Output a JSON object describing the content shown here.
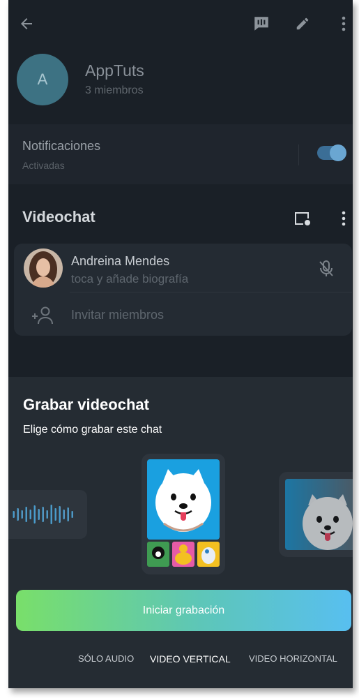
{
  "header": {
    "back_icon": "arrow-left-icon",
    "actions": [
      "voice-chat-icon",
      "pencil-icon",
      "more-vertical-icon"
    ]
  },
  "group": {
    "avatar_letter": "A",
    "name": "AppTuts",
    "members": "3 miembros"
  },
  "notifications": {
    "title": "Notificaciones",
    "status": "Activadas",
    "enabled": true
  },
  "videochat": {
    "title": "Videochat",
    "participant": {
      "name": "Andreina Mendes",
      "bio": "toca y añade biografía",
      "muted": true
    },
    "invite_label": "Invitar miembros"
  },
  "record_sheet": {
    "title": "Grabar videochat",
    "subtitle": "Elige cómo grabar este chat",
    "start_button": "Iniciar grabación",
    "modes": [
      "SÓLO AUDIO",
      "VIDEO VERTICAL",
      "VIDEO HORIZONTAL"
    ],
    "selected_mode": "VIDEO VERTICAL"
  },
  "colors": {
    "accent": "#3b6e96",
    "gradient_start": "#79df6a",
    "gradient_end": "#58bff0",
    "tile_bg": "#1aa0e0"
  }
}
